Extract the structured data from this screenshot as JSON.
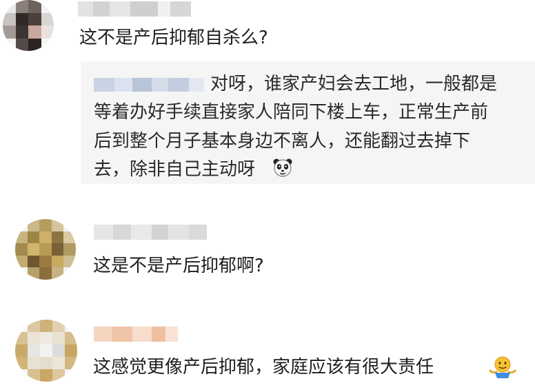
{
  "comments": [
    {
      "text": "这不是产后抑郁自杀么?"
    },
    {
      "text": "这是不是产后抑郁啊?"
    },
    {
      "text": "这感觉更像产后抑郁，家庭应该有很大责任"
    }
  ],
  "reply": {
    "lines": [
      "对呀，谁家产妇会去工地，一般都是",
      "等着办好手续直接家人陪同下楼上车，正常生产前",
      "后到整个月子基本身边不离人，还能翻过去掉下",
      "去，除非自己主动呀"
    ],
    "emoji": "panda-face-icon"
  },
  "comment_emoji": "shrug-face-icon",
  "colors": {
    "text": "#1e1e1e",
    "reply_background": "#f5f5f5",
    "page_background": "#ffffff"
  }
}
